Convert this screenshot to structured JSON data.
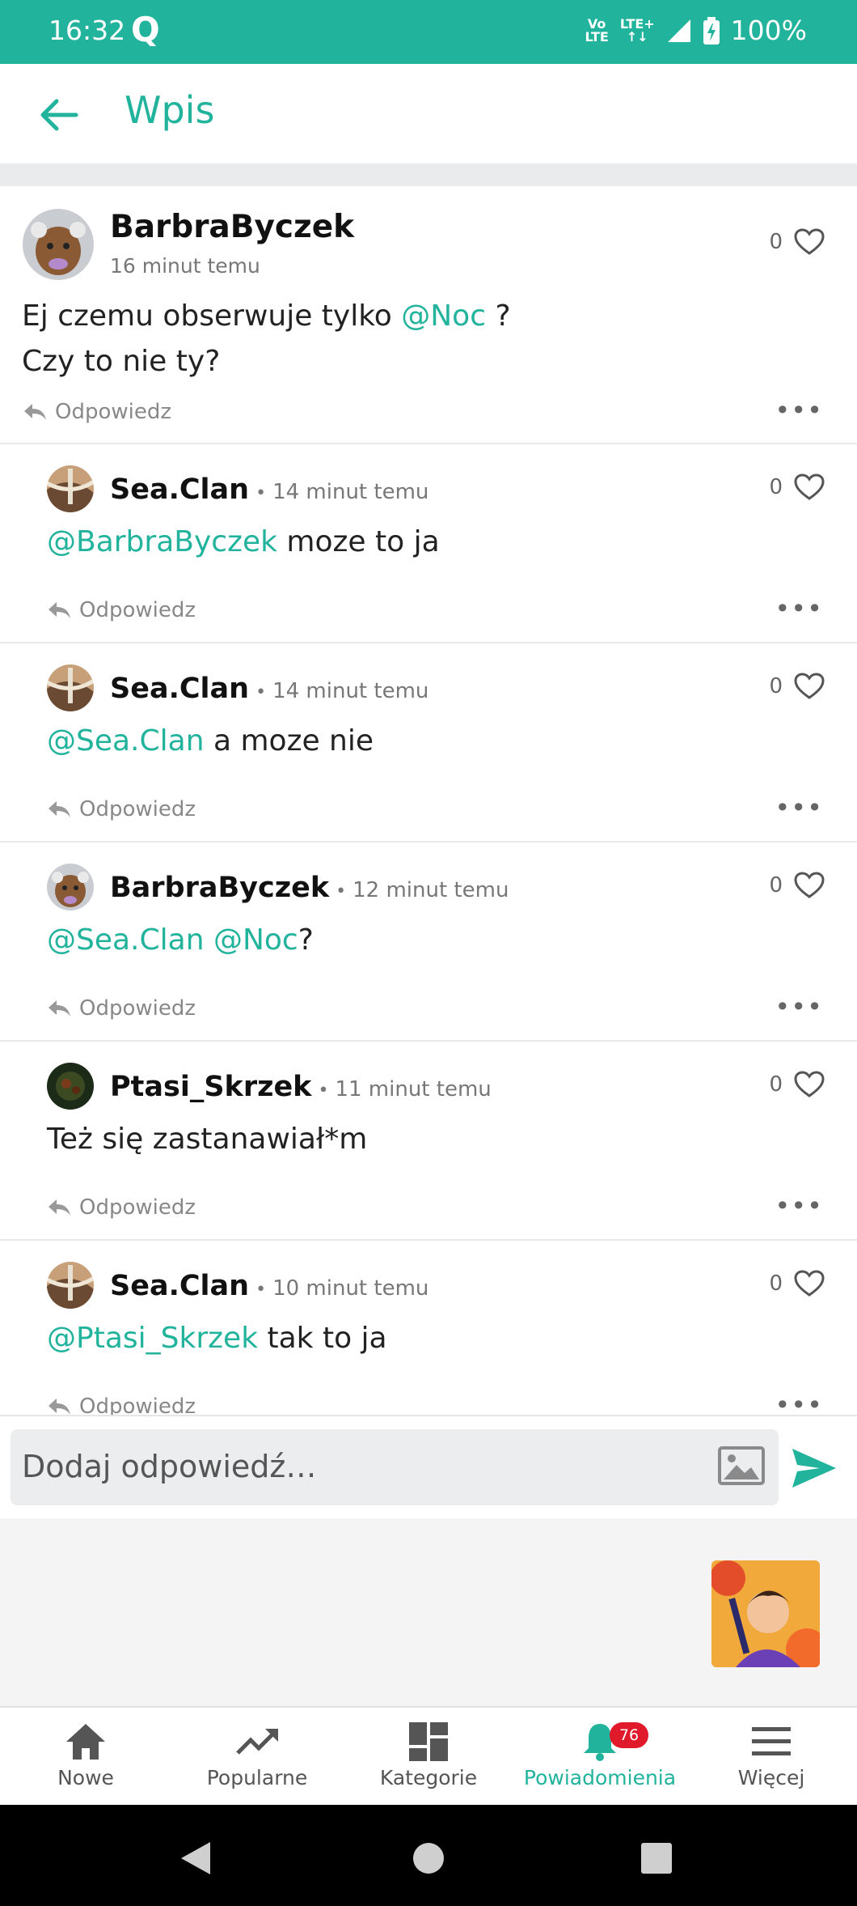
{
  "status_bar": {
    "time": "16:32",
    "app_icon": "Q",
    "net_left_top": "Vo",
    "net_left_bottom": "LTE",
    "net_right_top": "LTE+",
    "battery": "100%"
  },
  "header": {
    "title": "Wpis",
    "back_icon": "arrow-left-icon"
  },
  "post": {
    "author": "BarbraByczek",
    "time": "16 minut temu",
    "line1_text": "Ej czemu obserwuje tylko ",
    "line1_mention": "@Noc",
    "line1_suffix": " ?",
    "line2": "Czy to nie ty?",
    "likes": "0",
    "reply_label": "Odpowiedz",
    "more": "•••"
  },
  "replies": [
    {
      "author": "Sea.Clan",
      "sep": "•",
      "time": "14 minut temu",
      "mention": "@BarbraByczek",
      "mention2": "",
      "text": " moze to ja",
      "likes": "0",
      "reply_label": "Odpowiedz",
      "more": "•••"
    },
    {
      "author": "Sea.Clan",
      "sep": "•",
      "time": "14 minut temu",
      "mention": "@Sea.Clan",
      "mention2": "",
      "text": " a moze nie",
      "likes": "0",
      "reply_label": "Odpowiedz",
      "more": "•••"
    },
    {
      "author": "BarbraByczek",
      "sep": "•",
      "time": "12 minut temu",
      "mention": "@Sea.Clan",
      "mention2": " @Noc",
      "text": "?",
      "likes": "0",
      "reply_label": "Odpowiedz",
      "more": "•••"
    },
    {
      "author": "Ptasi_Skrzek",
      "sep": "•",
      "time": "11 minut temu",
      "mention": "",
      "mention2": "",
      "text": "Też się zastanawiał*m",
      "likes": "0",
      "reply_label": "Odpowiedz",
      "more": "•••"
    },
    {
      "author": "Sea.Clan",
      "sep": "•",
      "time": "10 minut temu",
      "mention": "@Ptasi_Skrzek",
      "mention2": "",
      "text": " tak to ja",
      "likes": "0",
      "reply_label": "Odpowiedz",
      "more": "•••"
    }
  ],
  "compose": {
    "placeholder": "Dodaj odpowiedź…"
  },
  "bottom_nav": [
    {
      "label": "Nowe",
      "icon": "home-icon"
    },
    {
      "label": "Popularne",
      "icon": "trending-icon"
    },
    {
      "label": "Kategorie",
      "icon": "grid-icon"
    },
    {
      "label": "Powiadomienia",
      "icon": "bell-icon",
      "badge": "76",
      "active": true
    },
    {
      "label": "Więcej",
      "icon": "menu-icon"
    }
  ],
  "colors": {
    "accent": "#22b39d",
    "badge": "#e0192b"
  }
}
